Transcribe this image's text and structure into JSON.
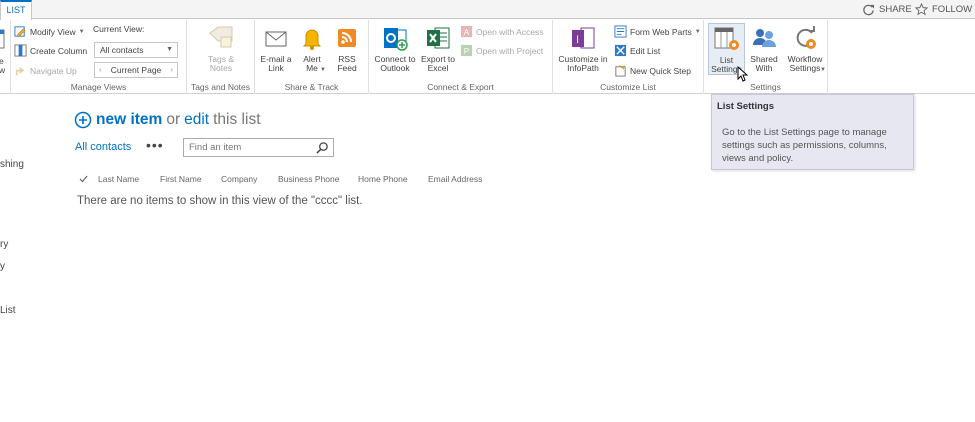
{
  "tabs": {
    "list": "LIST"
  },
  "top_actions": {
    "share": "SHARE",
    "follow": "FOLLOW"
  },
  "ribbon": {
    "view_format": {
      "label": "e\nw"
    },
    "manage_views": {
      "group_label": "Manage Views",
      "modify_view": "Modify View",
      "create_column": "Create Column",
      "navigate_up": "Navigate Up",
      "current_view_label": "Current View:",
      "current_view_value": "All contacts",
      "current_page": "Current Page"
    },
    "tags_notes": {
      "group_label": "Tags and Notes",
      "button": "Tags &\nNotes"
    },
    "share_track": {
      "group_label": "Share & Track",
      "email_link": "E-mail a\nLink",
      "alert_me": "Alert\nMe",
      "rss_feed": "RSS\nFeed"
    },
    "connect_export": {
      "group_label": "Connect & Export",
      "connect_outlook": "Connect to\nOutlook",
      "export_excel": "Export to\nExcel",
      "open_access": "Open with Access",
      "open_project": "Open with Project"
    },
    "customize_list": {
      "group_label": "Customize List",
      "customize_infopath": "Customize in\nInfoPath",
      "form_web_parts": "Form Web Parts",
      "edit_list": "Edit List",
      "new_quick_step": "New Quick Step"
    },
    "settings": {
      "group_label": "Settings",
      "list_settings": "List\nSettings",
      "shared_with": "Shared\nWith",
      "workflow_settings": "Workflow\nSettings"
    }
  },
  "leftnav": {
    "items": [
      "shing",
      "ry",
      "y",
      "List"
    ]
  },
  "main": {
    "new_item": "new item",
    "or": "or",
    "edit": "edit",
    "this_list": "this list",
    "view_name": "All contacts",
    "more": "•••",
    "search_placeholder": "Find an item",
    "columns": [
      "Last Name",
      "First Name",
      "Company",
      "Business Phone",
      "Home Phone",
      "Email Address"
    ],
    "empty_message": "There are no items to show in this view of the \"cccc\" list."
  },
  "tooltip": {
    "title": "List Settings",
    "body": "Go to the List Settings page to manage settings such as permissions, columns, views and policy."
  },
  "colors": {
    "accent": "#0072c6",
    "tooltip_bg": "#e7e7f2",
    "ribbon_border": "#d1d1d1"
  }
}
